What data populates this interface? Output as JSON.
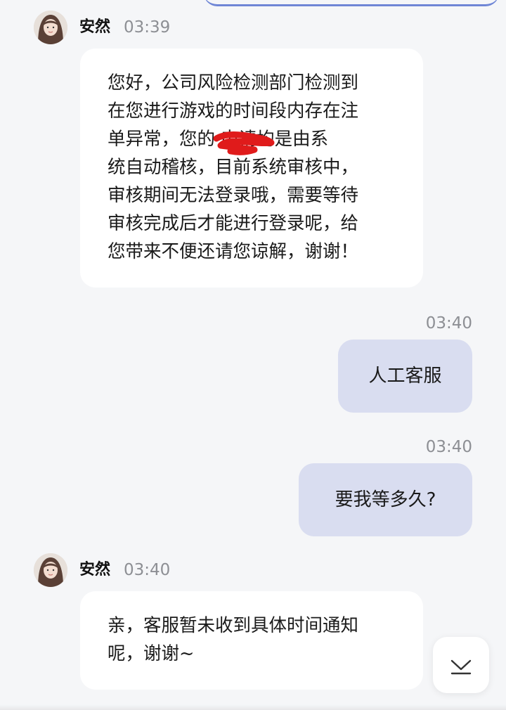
{
  "messages": {
    "m1": {
      "sender": "安然",
      "time": "03:39",
      "lines": [
        "您好，公司风险检测部门检测到",
        "在您进行游戏的时间段内存在注",
        "单异常，您的   申请均是由系",
        "统自动稽核，目前系统审核中，",
        "审核期间无法登录哦，需要等待",
        "审核完成后才能进行登录呢，给",
        "您带来不便还请您谅解，谢谢！"
      ]
    },
    "m2": {
      "time": "03:40",
      "text": "人工客服"
    },
    "m3": {
      "time": "03:40",
      "text": "要我等多久?"
    },
    "m4": {
      "sender": "安然",
      "time": "03:40",
      "lines": [
        "亲，客服暂未收到具体时间通知",
        "呢，谢谢~"
      ]
    }
  },
  "icons": {
    "avatar": "avatar-photo",
    "redaction": "red-scribble",
    "scroll_down": "chevron-down-icon"
  },
  "colors": {
    "page_background": "#f5f6f8",
    "incoming_bubble": "#ffffff",
    "outgoing_bubble": "#d9ddf0",
    "timestamp": "#8d8f94",
    "redaction": "#e01b1b",
    "accent": "#6f86d6"
  }
}
